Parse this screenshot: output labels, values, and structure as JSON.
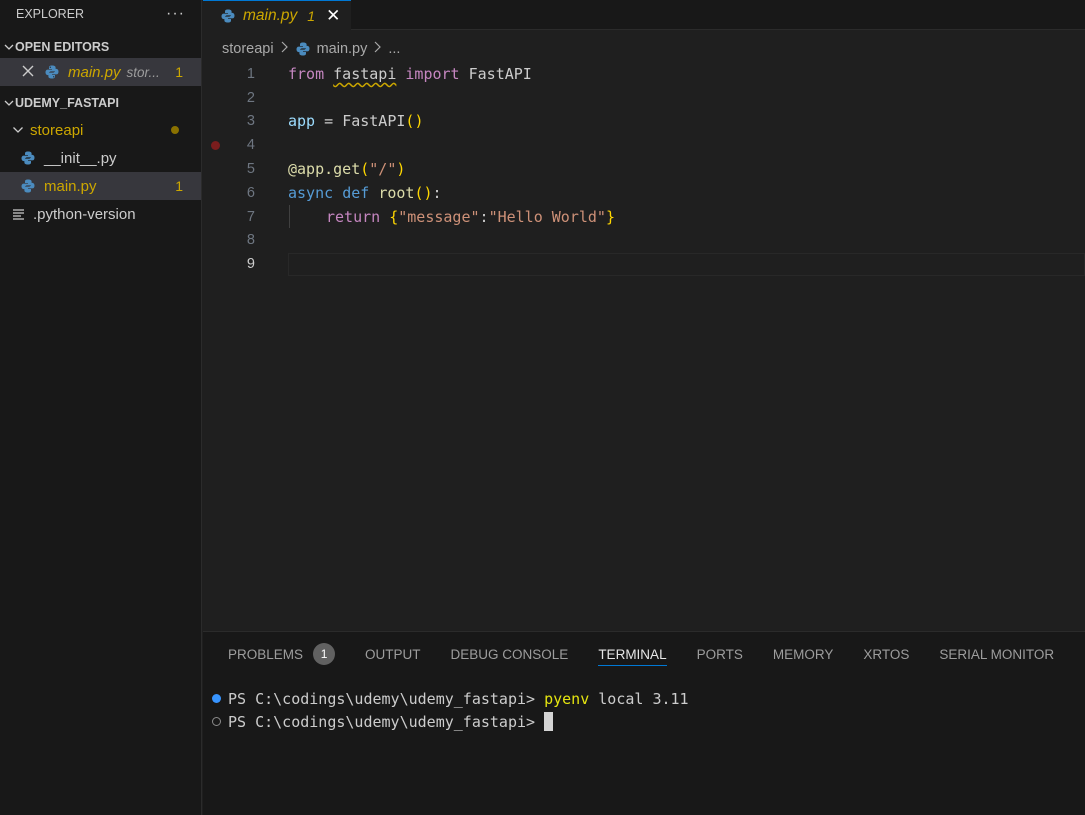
{
  "sidebar": {
    "title": "EXPLORER",
    "more": "···",
    "open_editors_label": "OPEN EDITORS",
    "open_editor": {
      "name": "main.py",
      "folder": "stor...",
      "problems": "1"
    },
    "project_label": "UDEMY_FASTAPI",
    "tree": {
      "folder": "storeapi",
      "files": [
        {
          "name": "__init__.py",
          "problems": ""
        },
        {
          "name": "main.py",
          "problems": "1"
        }
      ],
      "root_file": ".python-version"
    }
  },
  "tab": {
    "name": "main.py",
    "problems": "1",
    "close": "✕"
  },
  "breadcrumb": {
    "folder": "storeapi",
    "file": "main.py",
    "more": "..."
  },
  "editor": {
    "lines": [
      {
        "n": "1"
      },
      {
        "n": "2"
      },
      {
        "n": "3"
      },
      {
        "n": "4"
      },
      {
        "n": "5"
      },
      {
        "n": "6"
      },
      {
        "n": "7"
      },
      {
        "n": "8"
      },
      {
        "n": "9"
      }
    ],
    "code": {
      "l1": {
        "from": "from",
        "mod": "fastapi",
        "import": "import",
        "name": "FastAPI"
      },
      "l3": {
        "var": "app",
        "eq": " = ",
        "cls": "FastAPI",
        "open": "(",
        "close": ")"
      },
      "l5": {
        "at": "@app",
        "dot": ".get",
        "open": "(",
        "str": "\"/\"",
        "close": ")"
      },
      "l6": {
        "async": "async",
        "def": "def",
        "fn": "root",
        "open": "(",
        "close": ")",
        "colon": ":"
      },
      "l7": {
        "ret": "return",
        "lb": "{",
        "k": "\"message\"",
        "colon": ":",
        "v": "\"Hello World\"",
        "rb": "}"
      }
    }
  },
  "panel": {
    "tabs": [
      "PROBLEMS",
      "OUTPUT",
      "DEBUG CONSOLE",
      "TERMINAL",
      "PORTS",
      "MEMORY",
      "XRTOS",
      "SERIAL MONITOR"
    ],
    "problems_count": "1",
    "active_tab": "TERMINAL",
    "terminal": [
      {
        "prompt": "PS C:\\codings\\udemy\\udemy_fastapi> ",
        "cmd": "pyenv",
        "args": " local 3.11"
      },
      {
        "prompt": "PS C:\\codings\\udemy\\udemy_fastapi> ",
        "cmd": "",
        "args": ""
      }
    ]
  },
  "colors": {
    "accent": "#0078d4",
    "warning": "#cca700",
    "breakpoint": "#7a1d1d"
  }
}
